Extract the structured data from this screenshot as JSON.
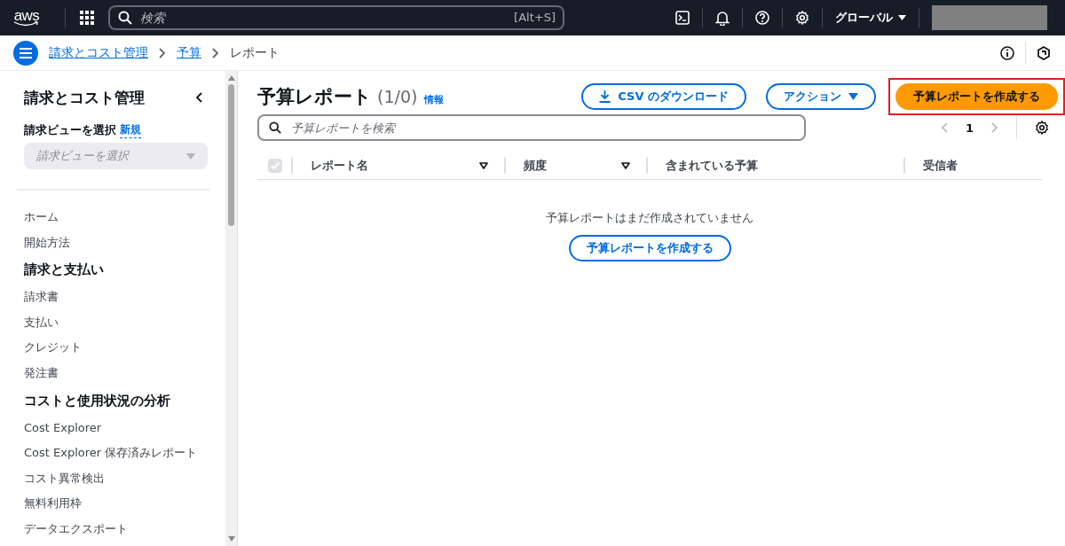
{
  "top_bar": {
    "logo": "aws",
    "search": {
      "placeholder": "検索",
      "shortcut": "[Alt+S]"
    },
    "region": "グローバル"
  },
  "breadcrumbs": [
    {
      "label": "請求とコスト管理",
      "link": true
    },
    {
      "label": "予算",
      "link": true
    },
    {
      "label": "レポート",
      "link": false
    }
  ],
  "sidebar": {
    "title": "請求とコスト管理",
    "view_label": "請求ビューを選択",
    "view_link": "新規",
    "view_select": {
      "placeholder": "請求ビューを選択"
    },
    "items": [
      {
        "kind": "link",
        "label": "ホーム"
      },
      {
        "kind": "link",
        "label": "開始方法"
      },
      {
        "kind": "heading",
        "label": "請求と支払い"
      },
      {
        "kind": "link",
        "label": "請求書"
      },
      {
        "kind": "link",
        "label": "支払い"
      },
      {
        "kind": "link",
        "label": "クレジット"
      },
      {
        "kind": "link",
        "label": "発注書"
      },
      {
        "kind": "heading",
        "label": "コストと使用状況の分析"
      },
      {
        "kind": "link",
        "label": "Cost Explorer"
      },
      {
        "kind": "link",
        "label": "Cost Explorer 保存済みレポート"
      },
      {
        "kind": "link",
        "label": "コスト異常検出"
      },
      {
        "kind": "link",
        "label": "無料利用枠"
      },
      {
        "kind": "link",
        "label": "データエクスポート"
      }
    ]
  },
  "page": {
    "title": "予算レポート",
    "count": "(1/0)",
    "info": "情報",
    "buttons": [
      {
        "kind": "download",
        "label": "CSV のダウンロード",
        "highlighted": false
      },
      {
        "kind": "dropdown",
        "label": "アクション",
        "highlighted": false
      },
      {
        "kind": "primary",
        "label": "予算レポートを作成する",
        "highlighted": true
      }
    ],
    "search": {
      "placeholder": "予算レポートを検索"
    },
    "pagination": {
      "page": "1"
    },
    "table": {
      "select_all": {
        "checked": true,
        "disabled": true
      },
      "columns": [
        {
          "label": "レポート名",
          "sortable": true
        },
        {
          "label": "頻度",
          "sortable": true
        },
        {
          "label": "含まれている予算",
          "sortable": false
        },
        {
          "label": "受信者",
          "sortable": false
        }
      ],
      "empty_message": "予算レポートはまだ作成されていません",
      "empty_button": "予算レポートを作成する"
    }
  }
}
